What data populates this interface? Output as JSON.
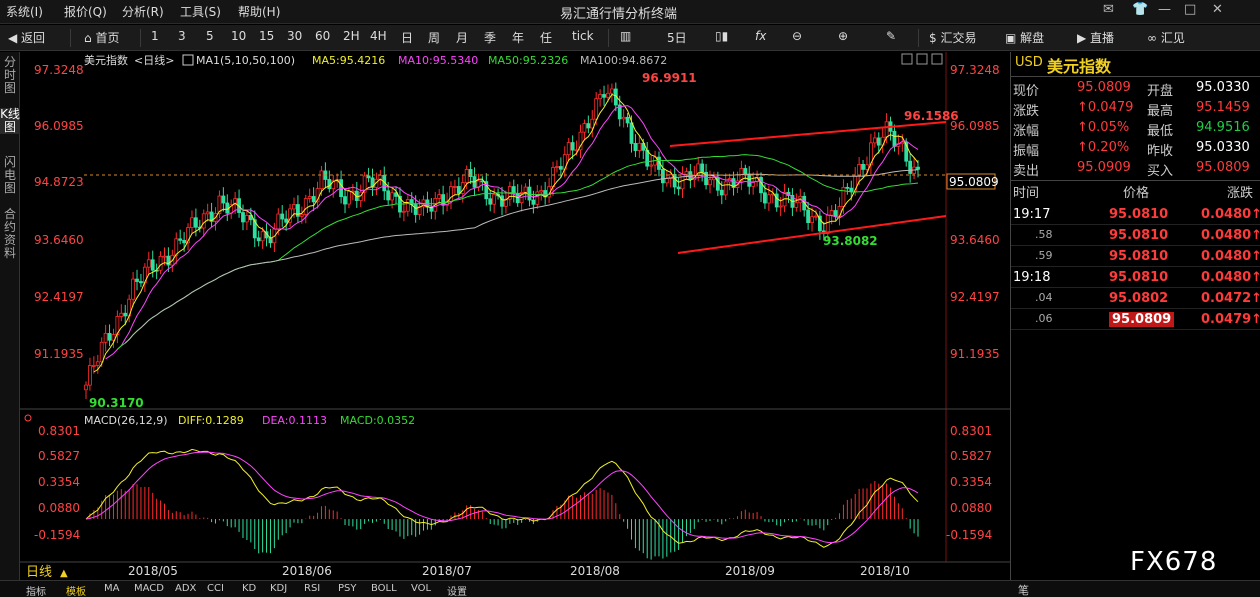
{
  "menubar": {
    "items": [
      "系统(I)",
      "报价(Q)",
      "分析(R)",
      "工具(S)",
      "帮助(H)"
    ],
    "title": "易汇通行情分析终端",
    "controls": [
      "✉",
      "👕",
      "—",
      "□",
      "✕"
    ]
  },
  "toolbar": {
    "back": "返回",
    "home": "首页",
    "periods": [
      "1",
      "3",
      "5",
      "10",
      "15",
      "30",
      "60",
      "2H",
      "4H",
      "日",
      "周",
      "月",
      "季",
      "年",
      "任",
      "tick"
    ],
    "five_day": "5日",
    "fx": "fx",
    "huijiaoyi": "汇交易",
    "jiepan": "解盘",
    "zhibo": "直播",
    "huijian": "汇见"
  },
  "lefttabs": [
    "分时图",
    "K线图",
    "闪电图",
    "合约资料"
  ],
  "chart": {
    "instrument": "美元指数",
    "period_label": "<日线>",
    "ma_legend": {
      "ma1": "MA1(5,10,50,100)",
      "ma5": "MA5:95.4216",
      "ma10": "MA10:95.5340",
      "ma50": "MA50:95.2326",
      "ma100": "MA100:94.8672"
    },
    "price_ticks": [
      "97.3248",
      "96.0985",
      "94.8723",
      "93.6460",
      "92.4197",
      "91.1935"
    ],
    "current_price_tag": "95.0809",
    "annotations": {
      "high": "96.9911",
      "channel_high": "96.1586",
      "low": "93.8082",
      "start_low": "90.3170"
    },
    "macd_legend": {
      "label": "MACD(26,12,9)",
      "diff": "DIFF:0.1289",
      "dea": "DEA:0.1113",
      "macd": "MACD:0.0352"
    },
    "macd_ticks": [
      "0.8301",
      "0.5827",
      "0.3354",
      "0.0880",
      "-0.1594"
    ],
    "date_labels": [
      "2018/05",
      "2018/06",
      "2018/07",
      "2018/08",
      "2018/09",
      "2018/10"
    ],
    "period_footer": "日线"
  },
  "quote": {
    "symbol": "USD",
    "name": "美元指数",
    "rows": [
      {
        "l1": "现价",
        "v1": "95.0809",
        "c1": "red",
        "l2": "开盘",
        "v2": "95.0330",
        "c2": "white"
      },
      {
        "l1": "涨跌",
        "v1": "↑0.0479",
        "c1": "red",
        "l2": "最高",
        "v2": "95.1459",
        "c2": "red"
      },
      {
        "l1": "涨幅",
        "v1": "↑0.05%",
        "c1": "red",
        "l2": "最低",
        "v2": "94.9516",
        "c2": "green"
      },
      {
        "l1": "振幅",
        "v1": "↑0.20%",
        "c1": "red",
        "l2": "昨收",
        "v2": "95.0330",
        "c2": "white"
      },
      {
        "l1": "卖出",
        "v1": "95.0909",
        "c1": "red",
        "l2": "买入",
        "v2": "95.0809",
        "c2": "red"
      }
    ],
    "tick_header": {
      "time": "时间",
      "price": "价格",
      "change": "涨跌"
    },
    "ticks": [
      {
        "time": "19:17",
        "price": "95.0810",
        "change": "0.0480↑"
      },
      {
        "time": ".58",
        "price": "95.0810",
        "change": "0.0480↑"
      },
      {
        "time": ".59",
        "price": "95.0810",
        "change": "0.0480↑"
      },
      {
        "time": "19:18",
        "price": "95.0810",
        "change": "0.0480↑"
      },
      {
        "time": ".04",
        "price": "95.0802",
        "change": "0.0472↑"
      },
      {
        "time": ".06",
        "price": "95.0809",
        "change": "0.0479↑"
      }
    ],
    "footer": "笔"
  },
  "bottom_tabs": [
    "指标",
    "模板",
    "MA",
    "MACD",
    "ADX",
    "CCI",
    "KD",
    "KDJ",
    "RSI",
    "PSY",
    "BOLL",
    "VOL",
    "设置"
  ],
  "watermark": "FX678",
  "chart_data": {
    "type": "candlestick",
    "title": "美元指数 日线",
    "y_range": [
      90.0,
      97.5
    ],
    "macd_range": [
      -0.28,
      0.9
    ],
    "x_labels": [
      "2018/05",
      "2018/06",
      "2018/07",
      "2018/08",
      "2018/09",
      "2018/10"
    ],
    "annotated_points": {
      "high": 96.9911,
      "channel_high": 96.1586,
      "low": 93.8082,
      "start_low": 90.317
    },
    "last_price": 95.0809,
    "macd": {
      "diff": 0.1289,
      "dea": 0.1113,
      "macd": 0.0352
    }
  }
}
